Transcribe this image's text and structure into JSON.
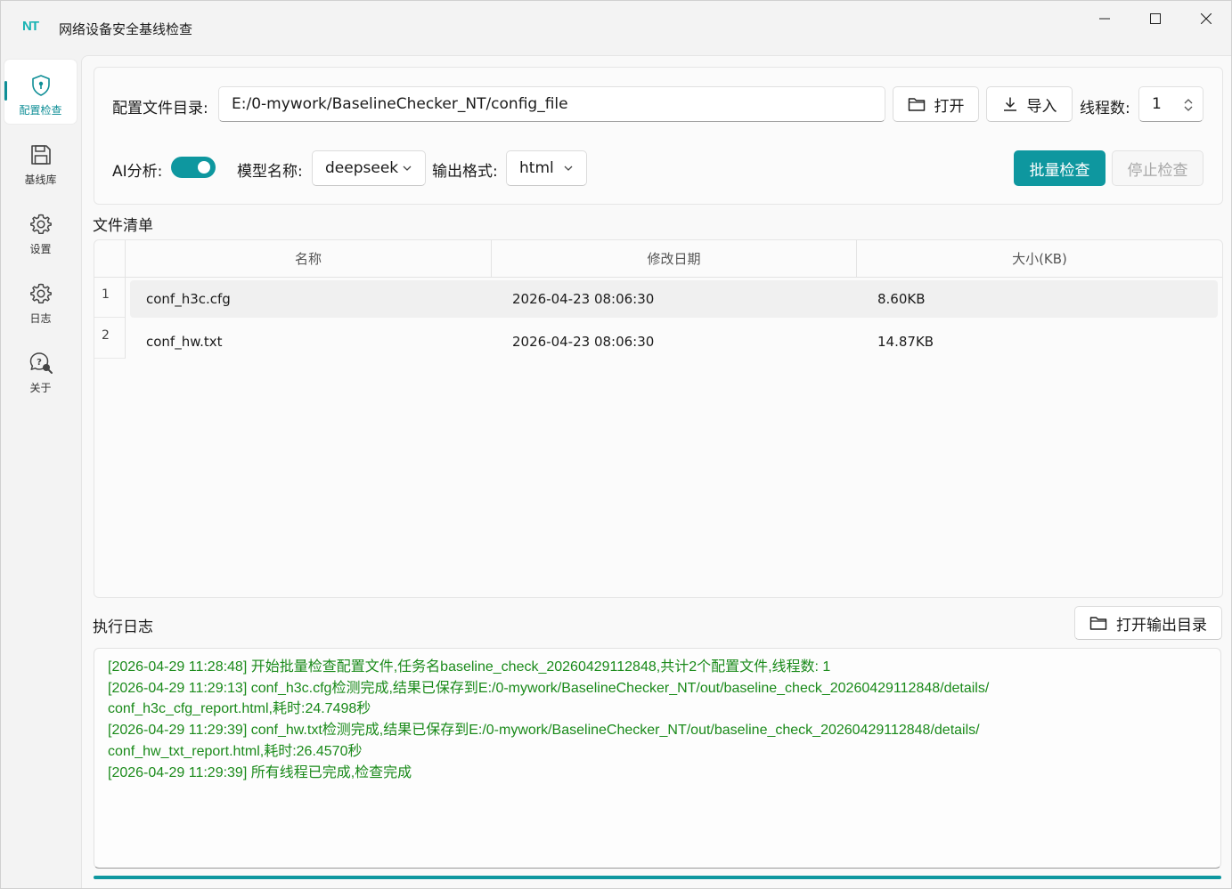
{
  "app": {
    "logo": "NT",
    "title": "网络设备安全基线检查"
  },
  "window_controls": {
    "minimize": "minimize-icon",
    "maximize": "maximize-icon",
    "close": "close-icon"
  },
  "sidebar": {
    "items": [
      {
        "label": "配置检查",
        "icon": "shield-icon",
        "active": true
      },
      {
        "label": "基线库",
        "icon": "save-icon",
        "active": false
      },
      {
        "label": "设置",
        "icon": "gear-icon",
        "active": false
      },
      {
        "label": "日志",
        "icon": "gear-icon",
        "active": false
      },
      {
        "label": "关于",
        "icon": "help-search-icon",
        "active": false
      }
    ]
  },
  "config": {
    "dir_label": "配置文件目录:",
    "dir_value": "E:/0-mywork/BaselineChecker_NT/config_file",
    "open_label": "打开",
    "import_label": "导入",
    "threads_label": "线程数:",
    "threads_value": "1",
    "ai_label": "AI分析:",
    "ai_enabled": true,
    "model_label": "模型名称:",
    "model_value": "deepseek",
    "format_label": "输出格式:",
    "format_value": "html",
    "batch_check_label": "批量检查",
    "stop_check_label": "停止检查"
  },
  "file_list": {
    "title": "文件清单",
    "columns": [
      "名称",
      "修改日期",
      "大小(KB)"
    ],
    "rows": [
      {
        "index": "1",
        "name": "conf_h3c.cfg",
        "modified": "2026-04-23 08:06:30",
        "size": "8.60KB"
      },
      {
        "index": "2",
        "name": "conf_hw.txt",
        "modified": "2026-04-23 08:06:30",
        "size": "14.87KB"
      }
    ]
  },
  "log": {
    "title": "执行日志",
    "open_output_label": "打开输出目录",
    "lines": [
      "[2026-04-29 11:28:48] 开始批量检查配置文件,任务名baseline_check_20260429112848,共计2个配置文件,线程数: 1",
      "[2026-04-29 11:29:13] conf_h3c.cfg检测完成,结果已保存到E:/0-mywork/BaselineChecker_NT/out/baseline_check_20260429112848/details/",
      "conf_h3c_cfg_report.html,耗时:24.7498秒",
      "[2026-04-29 11:29:39] conf_hw.txt检测完成,结果已保存到E:/0-mywork/BaselineChecker_NT/out/baseline_check_20260429112848/details/",
      "conf_hw_txt_report.html,耗时:26.4570秒",
      "[2026-04-29 11:29:39] 所有线程已完成,检查完成"
    ]
  },
  "progress": {
    "value": 1.0
  },
  "colors": {
    "accent": "#0e979f",
    "log_text": "#1a8a1a"
  }
}
